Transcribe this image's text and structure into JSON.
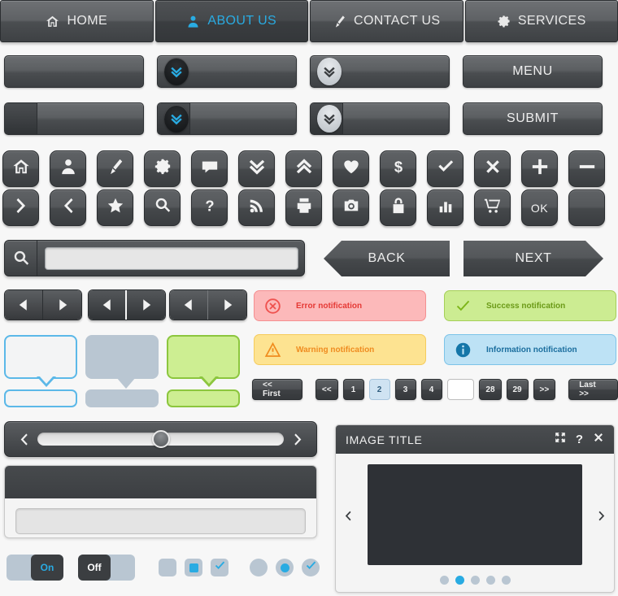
{
  "nav": {
    "items": [
      {
        "label": "HOME",
        "icon": "home-icon",
        "active": false
      },
      {
        "label": "ABOUT US",
        "icon": "user-icon",
        "active": true
      },
      {
        "label": "CONTACT US",
        "icon": "pencil-icon",
        "active": false
      },
      {
        "label": "SERVICES",
        "icon": "gear-icon",
        "active": false
      }
    ],
    "active_color": "#29abe2"
  },
  "buttons": {
    "row1": [
      {
        "label": "",
        "badge": "none"
      },
      {
        "label": "",
        "badge": "dark-chevrons-down"
      },
      {
        "label": "",
        "badge": "light-chevrons-down"
      },
      {
        "label": "MENU",
        "badge": "none"
      }
    ],
    "row2": [
      {
        "label": "",
        "badge": "none",
        "split": true
      },
      {
        "label": "",
        "badge": "dark-chevrons-down",
        "split": true
      },
      {
        "label": "",
        "badge": "light-chevrons-down",
        "split": true
      },
      {
        "label": "SUBMIT",
        "badge": "none",
        "split": false
      }
    ]
  },
  "icon_grid": {
    "row1": [
      "home-icon",
      "user-icon",
      "pencil-icon",
      "gear-icon",
      "chat-icon",
      "chevrons-down-icon",
      "chevrons-up-icon",
      "heart-icon",
      "dollar-icon",
      "check-icon",
      "close-icon",
      "plus-icon",
      "minus-icon"
    ],
    "row2": [
      "chevron-right-icon",
      "chevron-left-icon",
      "star-icon",
      "search-icon",
      "question-icon",
      "rss-icon",
      "printer-icon",
      "camera-icon",
      "lock-icon",
      "bar-chart-icon",
      "cart-icon",
      "ok-label",
      "blank"
    ],
    "ok_label": "OK"
  },
  "search": {
    "placeholder": "",
    "value": "",
    "icon": "search-icon"
  },
  "arrows": {
    "back": "BACK",
    "next": "NEXT"
  },
  "notifications": [
    {
      "type": "error",
      "label": "Error notification",
      "icon": "x-circle-icon",
      "bg": "#fcb9ba",
      "fg": "#e53935"
    },
    {
      "type": "success",
      "label": "Success notification",
      "icon": "check-circle-icon",
      "bg": "#ccec92",
      "fg": "#6b9a17"
    },
    {
      "type": "warning",
      "label": "Warning notification",
      "icon": "warning-triangle-icon",
      "bg": "#fde391",
      "fg": "#ef8c20"
    },
    {
      "type": "information",
      "label": "Information notification",
      "icon": "info-circle-icon",
      "bg": "#bde2f5",
      "fg": "#1b6e9e"
    }
  ],
  "bubbles": [
    {
      "style": "blue-outline",
      "color": "#5bb8e8"
    },
    {
      "style": "gray-solid",
      "color": "#b9c6d2"
    },
    {
      "style": "green",
      "color": "#8cc63e"
    }
  ],
  "pagination": {
    "first": "<< First",
    "prev": "<<",
    "pages": [
      "1",
      "2",
      "3",
      "4"
    ],
    "blank": "",
    "tail_pages": [
      "28",
      "29"
    ],
    "next": ">>",
    "last": "Last >>",
    "active_page": "2",
    "active_color": "#cfe3f2"
  },
  "slider": {
    "value_percent": 50,
    "prev_icon": "chevron-left-icon",
    "next_icon": "chevron-right-icon"
  },
  "form_panel": {
    "input_value": "",
    "input_placeholder": ""
  },
  "toggles": [
    {
      "state": "On",
      "label": "On",
      "label_color": "#29abe2"
    },
    {
      "state": "Off",
      "label": "Off",
      "label_color": "#ffffff"
    }
  ],
  "checkboxes": [
    {
      "name": "checkbox-empty",
      "state": "empty"
    },
    {
      "name": "checkbox-filled",
      "state": "filled-square"
    },
    {
      "name": "checkbox-checked",
      "state": "checked"
    }
  ],
  "radios": [
    {
      "name": "radio-empty",
      "state": "empty"
    },
    {
      "name": "radio-selected",
      "state": "dot"
    },
    {
      "name": "radio-checked",
      "state": "checked"
    }
  ],
  "viewer": {
    "title": "IMAGE TITLE",
    "actions": [
      "fullscreen-icon",
      "help-icon",
      "close-icon"
    ],
    "help_glyph": "?",
    "dots_total": 5,
    "dot_active_index": 1,
    "prev_icon": "chevron-left-icon",
    "next_icon": "chevron-right-icon"
  }
}
